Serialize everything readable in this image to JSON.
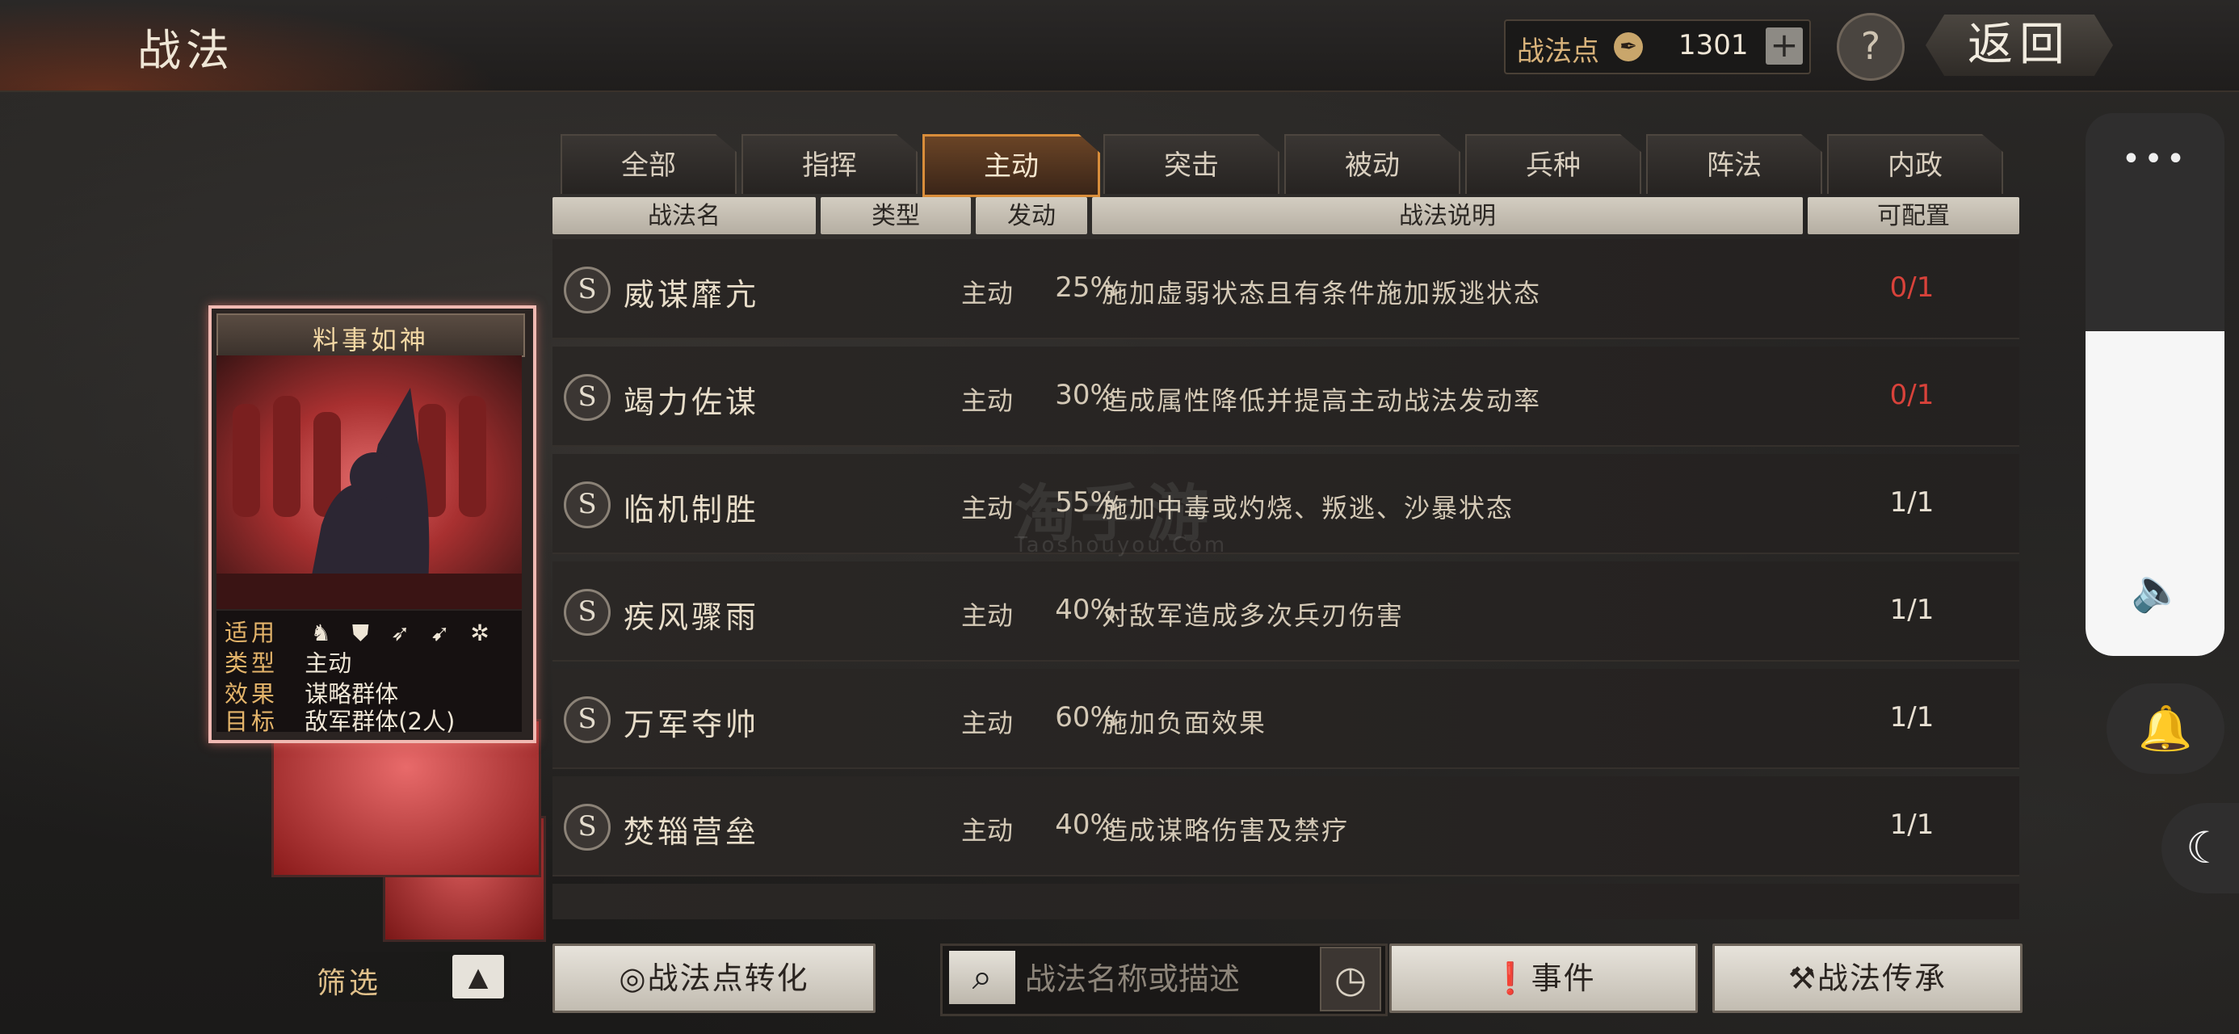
{
  "header": {
    "title": "战法",
    "points_label": "战法点",
    "points_value": "1301",
    "add_label": "+",
    "help_label": "?",
    "back_label": "返回"
  },
  "tabs": [
    {
      "label": "全部",
      "active": false
    },
    {
      "label": "指挥",
      "active": false
    },
    {
      "label": "主动",
      "active": true
    },
    {
      "label": "突击",
      "active": false
    },
    {
      "label": "被动",
      "active": false
    },
    {
      "label": "兵种",
      "active": false
    },
    {
      "label": "阵法",
      "active": false
    },
    {
      "label": "内政",
      "active": false
    }
  ],
  "columns": {
    "name": "战法名",
    "type": "类型",
    "rate": "发动",
    "desc": "战法说明",
    "avail": "可配置"
  },
  "rows": [
    {
      "grade": "S",
      "name": "威谋靡亢",
      "type": "主动",
      "rate": "25%",
      "desc": "施加虚弱状态且有条件施加叛逃状态",
      "avail": "0/1"
    },
    {
      "grade": "S",
      "name": "竭力佐谋",
      "type": "主动",
      "rate": "30%",
      "desc": "造成属性降低并提高主动战法发动率",
      "avail": "0/1"
    },
    {
      "grade": "S",
      "name": "临机制胜",
      "type": "主动",
      "rate": "55%",
      "desc": "施加中毒或灼烧、叛逃、沙暴状态",
      "avail": "1/1"
    },
    {
      "grade": "S",
      "name": "疾风骤雨",
      "type": "主动",
      "rate": "40%",
      "desc": "对敌军造成多次兵刃伤害",
      "avail": "1/1"
    },
    {
      "grade": "S",
      "name": "万军夺帅",
      "type": "主动",
      "rate": "60%",
      "desc": "施加负面效果",
      "avail": "1/1"
    },
    {
      "grade": "S",
      "name": "焚辎营垒",
      "type": "主动",
      "rate": "40%",
      "desc": "造成谋略伤害及禁疗",
      "avail": "1/1"
    }
  ],
  "watermark": {
    "main": "淘手游",
    "sub": "Taoshouyou.Com"
  },
  "card": {
    "title": "料事如神",
    "apply_label": "适用",
    "apply_icons": [
      "cavalry-icon",
      "shield-icon",
      "bow-icon",
      "spear-icon",
      "siege-icon"
    ],
    "type_label": "类型",
    "type_value": "主动",
    "effect_label": "效果",
    "effect_value": "谋略群体",
    "target_label": "目标",
    "target_value": "敌军群体(2人)"
  },
  "footer": {
    "filter_label": "筛选",
    "convert_label": "战法点转化",
    "search_placeholder": "战法名称或描述",
    "event_label": "事件",
    "inherit_label": "战法传承"
  },
  "colors": {
    "accent": "#d98d3a",
    "unavailable": "#d8423a"
  }
}
